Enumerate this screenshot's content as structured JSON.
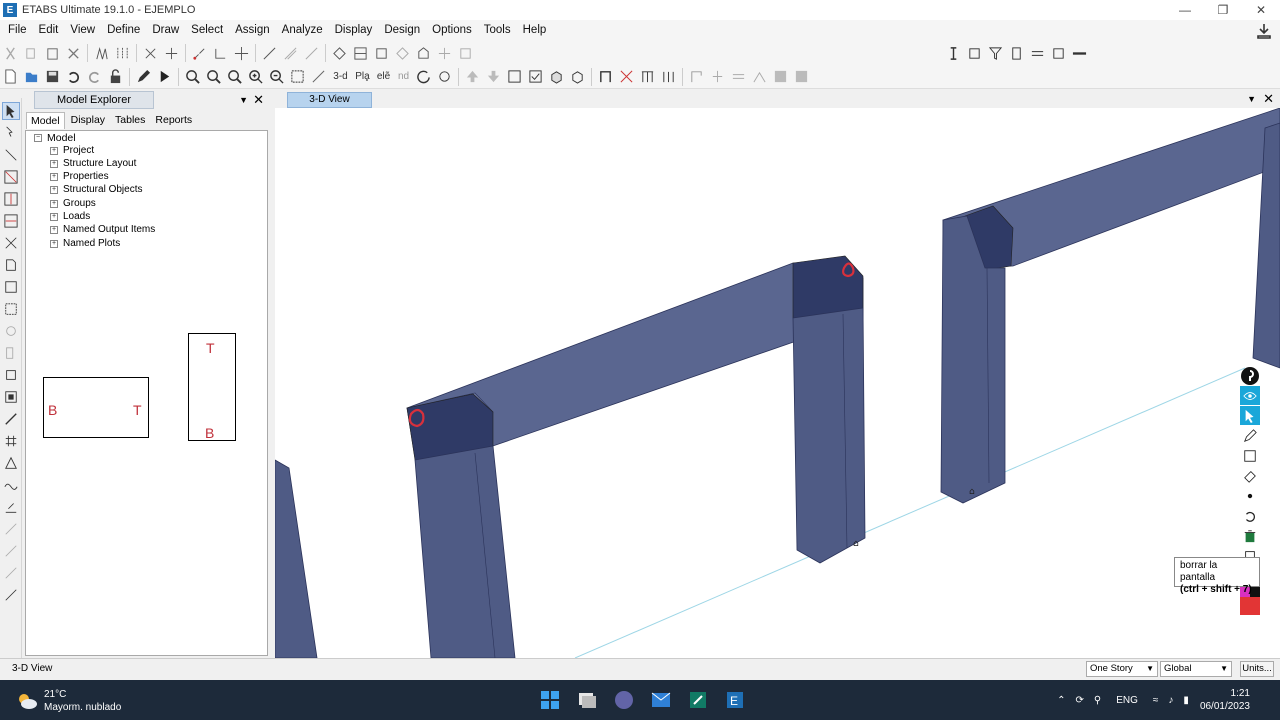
{
  "window": {
    "title": "ETABS Ultimate 19.1.0 - EJEMPLO",
    "icon": "E",
    "controls": [
      "minimize-icon",
      "maximize-icon",
      "close-icon"
    ]
  },
  "menu": [
    "File",
    "Edit",
    "View",
    "Define",
    "Draw",
    "Select",
    "Assign",
    "Analyze",
    "Display",
    "Design",
    "Options",
    "Tools",
    "Help"
  ],
  "toolbar2": {
    "view3d_label": "3-d",
    "plan_label": "Plḁ",
    "elev_label": "elẽ",
    "nd_label": "nd"
  },
  "explorer": {
    "title": "Model Explorer",
    "tabs": [
      "Model",
      "Display",
      "Tables",
      "Reports"
    ],
    "root": "Model",
    "items": [
      "Project",
      "Structure Layout",
      "Properties",
      "Structural Objects",
      "Groups",
      "Loads",
      "Named Output Items",
      "Named Plots"
    ]
  },
  "sketch": {
    "box1_left": "B",
    "box1_right": "T",
    "box2_top": "T",
    "box2_bottom": "B"
  },
  "view": {
    "tab_label": "3-D View"
  },
  "tooltip": {
    "line1": "borrar la pantalla",
    "line2": "(ctrl + shift + 7)"
  },
  "status": {
    "left_text": "3-D View",
    "story": "One Story",
    "coord": "Global",
    "units": "Units..."
  },
  "taskbar": {
    "temp": "21°C",
    "weather": "Mayorm. nublado",
    "lang": "ENG",
    "time": "1:21",
    "date": "06/01/2023"
  },
  "colors": {
    "frame_fill": "#4f5b85",
    "frame_joint": "#2f3a66",
    "annotation_red": "#d8303c",
    "view_tab": "#b7d3ee"
  }
}
